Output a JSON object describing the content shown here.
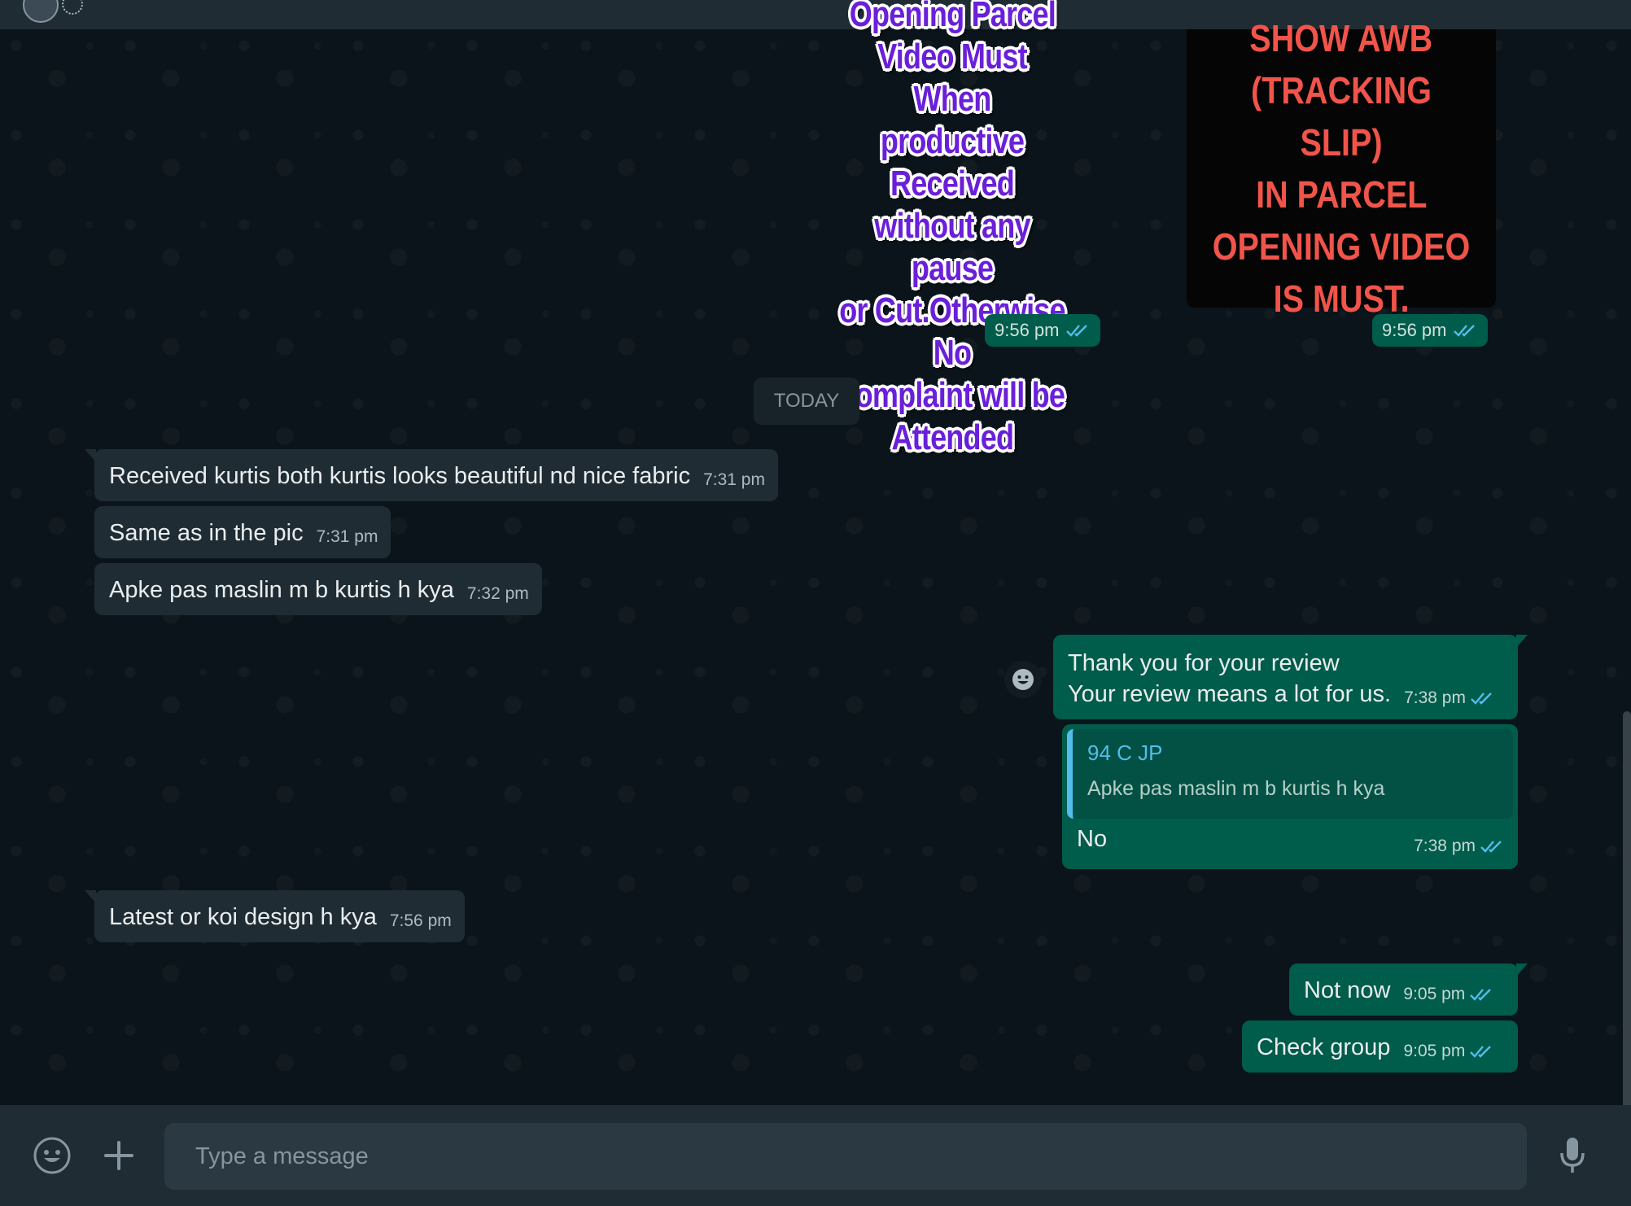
{
  "stickers": {
    "left_lines": [
      "Opening Parcel",
      "Video Must When",
      "productive Received",
      "without any pause",
      "or Cut.Otherwise No",
      "complaint will be",
      "Attended"
    ],
    "right_lines": [
      "SHOW AWB",
      "(TRACKING SLIP)",
      "IN PARCEL",
      "OPENING VIDEO",
      "IS MUST."
    ],
    "left_time": "9:56 pm",
    "right_time": "9:56 pm"
  },
  "date_divider": "TODAY",
  "messages": [
    {
      "text": "Received kurtis both kurtis looks beautiful nd nice fabric",
      "time": "7:31 pm",
      "direction": "in"
    },
    {
      "text": "Same as in the pic",
      "time": "7:31 pm",
      "direction": "in"
    },
    {
      "text": "Apke pas maslin m b kurtis h kya",
      "time": "7:32 pm",
      "direction": "in"
    },
    {
      "text": "Thank you for your review\nYour review means a lot for us.",
      "time": "7:38 pm",
      "direction": "out"
    },
    {
      "text": "Latest or koi design h kya",
      "time": "7:56 pm",
      "direction": "in"
    },
    {
      "text": "Not now",
      "time": "9:05 pm",
      "direction": "out"
    },
    {
      "text": "Check group",
      "time": "9:05 pm",
      "direction": "out"
    }
  ],
  "reply": {
    "quoted_name": "94 C JP",
    "quoted_text": "Apke pas maslin m b kurtis h kya",
    "text": "No",
    "time": "7:38 pm"
  },
  "composer": {
    "placeholder": "Type a message",
    "emoji_icon": "emoji-icon",
    "attach_icon": "plus-icon",
    "mic_icon": "mic-icon"
  },
  "colors": {
    "background": "#0b141a",
    "incoming_bubble": "#202c33",
    "outgoing_bubble": "#005c4b",
    "read_ticks": "#53bdeb",
    "sticker_text_purple": "#6a1fd8",
    "sticker_text_red": "#f0544a"
  }
}
